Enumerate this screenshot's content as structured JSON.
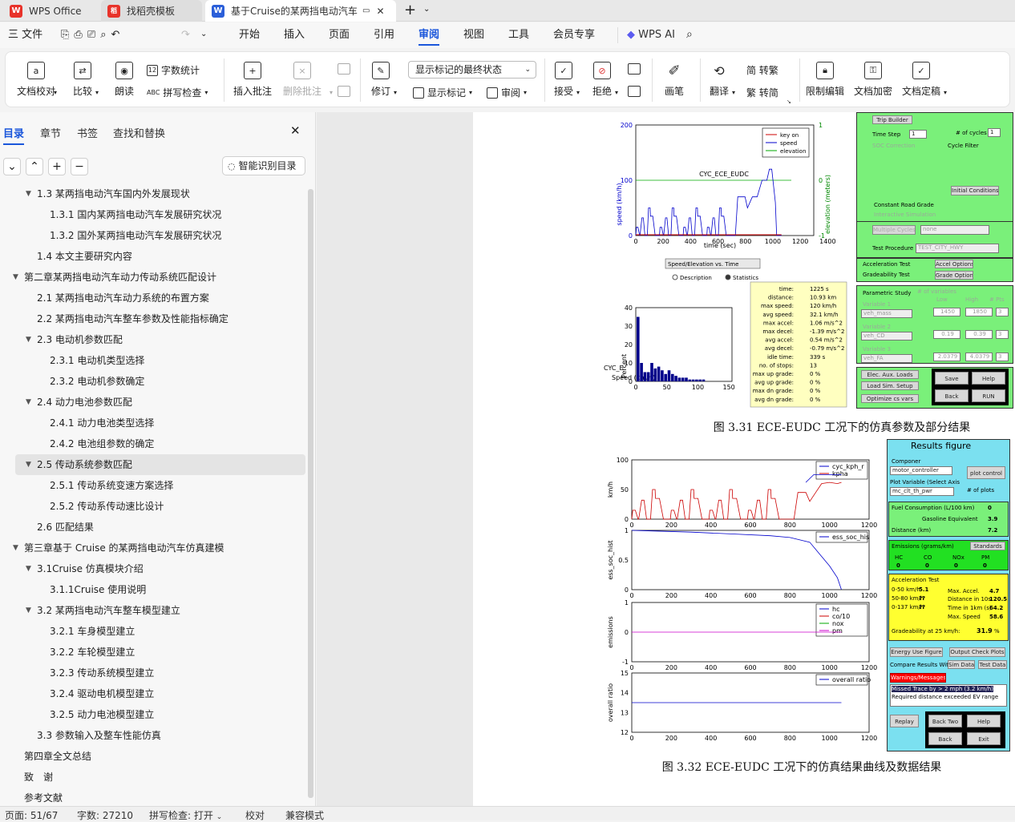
{
  "titlebar": {
    "tabs": [
      {
        "label": "WPS Office",
        "logo": "W"
      },
      {
        "label": "找稻壳模板",
        "logo": "稻"
      },
      {
        "label": "基于Cruise的某两挡电动汽车",
        "logo": "W"
      }
    ],
    "colors": {
      "wps_red": "#e8332a",
      "word_blue": "#2b5fd9",
      "accent": "#1a56db"
    }
  },
  "menubar": {
    "file": "三 文件",
    "items": [
      "开始",
      "插入",
      "页面",
      "引用",
      "审阅",
      "视图",
      "工具",
      "会员专享"
    ],
    "active": "审阅",
    "ai": "WPS AI"
  },
  "ribbon": {
    "proofread": "文档校对",
    "compare": "比较",
    "read_aloud": "朗读",
    "word_count": "字数统计",
    "spell_check": "拼写检查",
    "insert_comment": "插入批注",
    "delete_comment": "删除批注",
    "revise": "修订",
    "markup_dropdown": "显示标记的最终状态",
    "show_markup": "显示标记",
    "review": "审阅",
    "accept": "接受",
    "reject": "拒绝",
    "pen": "画笔",
    "translate": "翻译",
    "to_traditional": "简 转繁",
    "to_simplified": "繁 转简",
    "restrict_edit": "限制编辑",
    "encrypt": "文档加密",
    "finalize": "文档定稿"
  },
  "nav": {
    "tabs": [
      "目录",
      "章节",
      "书签",
      "查找和替换"
    ],
    "smart_toc": "智能识别目录",
    "toc": [
      {
        "text": "1.3 某两挡电动汽车国内外发展现状",
        "level": 2,
        "arrow": "down"
      },
      {
        "text": "1.3.1 国内某两挡电动汽车发展研究状况",
        "level": 3
      },
      {
        "text": "1.3.2 国外某两挡电动汽车发展研究状况",
        "level": 3
      },
      {
        "text": "1.4 本文主要研究内容",
        "level": 2
      },
      {
        "text": "第二章某两挡电动汽车动力传动系统匹配设计",
        "level": 1,
        "arrow": "down"
      },
      {
        "text": "2.1 某两挡电动汽车动力系统的布置方案",
        "level": 2
      },
      {
        "text": "2.2 某两挡电动汽车整车参数及性能指标确定",
        "level": 2
      },
      {
        "text": "2.3 电动机参数匹配",
        "level": 2,
        "arrow": "down"
      },
      {
        "text": "2.3.1 电动机类型选择",
        "level": 3
      },
      {
        "text": "2.3.2 电动机参数确定",
        "level": 3
      },
      {
        "text": "2.4 动力电池参数匹配",
        "level": 2,
        "arrow": "down"
      },
      {
        "text": "2.4.1 动力电池类型选择",
        "level": 3
      },
      {
        "text": "2.4.2 电池组参数的确定",
        "level": 3
      },
      {
        "text": "2.5 传动系统参数匹配",
        "level": 2,
        "arrow": "down",
        "selected": true
      },
      {
        "text": "2.5.1 传动系统变速方案选择",
        "level": 3
      },
      {
        "text": "2.5.2 传动系传动速比设计",
        "level": 3
      },
      {
        "text": "2.6 匹配结果",
        "level": 2
      },
      {
        "text": "第三章基于 Cruise 的某两挡电动汽车仿真建模",
        "level": 1,
        "arrow": "down"
      },
      {
        "text": "3.1Cruise 仿真模块介绍",
        "level": 2,
        "arrow": "down"
      },
      {
        "text": "3.1.1Cruise 使用说明",
        "level": 3
      },
      {
        "text": "3.2 某两挡电动汽车整车模型建立",
        "level": 2,
        "arrow": "down"
      },
      {
        "text": "3.2.1 车身模型建立",
        "level": 3
      },
      {
        "text": "3.2.2 车轮模型建立",
        "level": 3
      },
      {
        "text": "3.2.3 传动系统模型建立",
        "level": 3
      },
      {
        "text": "3.2.4 驱动电机模型建立",
        "level": 3
      },
      {
        "text": "3.2.5 动力电池模型建立",
        "level": 3
      },
      {
        "text": "3.3 参数输入及整车性能仿真",
        "level": 2
      },
      {
        "text": "第四章全文总结",
        "level": 1
      },
      {
        "text": "致　谢",
        "level": 1
      },
      {
        "text": "参考文献",
        "level": 1
      }
    ]
  },
  "status": {
    "page": "页面: 51/67",
    "words": "字数: 27210",
    "spell": "拼写检查: 打开",
    "proof": "校对",
    "compat": "兼容模式"
  },
  "figure1": {
    "caption": "图 3.31 ECE-EUDC 工况下的仿真参数及部分结果",
    "speed_plot": {
      "ylabel": "speed (km/h)",
      "y2label": "elevation (meters)",
      "xlabel": "time (sec)",
      "cycle": "CYC_ECE_EUDC",
      "yticks": [
        "200",
        "100",
        "0"
      ],
      "y2ticks": [
        "1",
        "0",
        "-1"
      ],
      "xticks": [
        "0",
        "200",
        "400",
        "600",
        "800",
        "1000",
        "1200",
        "1400"
      ],
      "legend": [
        "key on",
        "speed",
        "elevation"
      ]
    },
    "dropdown": "Speed/Elevation vs. Time",
    "radio_desc": "Description",
    "radio_stats": "Statistics",
    "hist": {
      "yticks": [
        "40",
        "30",
        "20",
        "10",
        "0"
      ],
      "xticks": [
        "0",
        "50",
        "100",
        "150"
      ],
      "ylabel": "Percent",
      "label1": "CYC_E",
      "label2": "Speed (km/h)"
    },
    "stats": [
      [
        "time:",
        "1225 s"
      ],
      [
        "distance:",
        "10.93 km"
      ],
      [
        "max speed:",
        "120 km/h"
      ],
      [
        "avg speed:",
        "32.1 km/h"
      ],
      [
        "max accel:",
        "1.06 m/s^2"
      ],
      [
        "max decel:",
        "-1.39 m/s^2"
      ],
      [
        "avg accel:",
        "0.54 m/s^2"
      ],
      [
        "avg decel:",
        "-0.79 m/s^2"
      ],
      [
        "idle time:",
        "339 s"
      ],
      [
        "no. of stops:",
        "13"
      ],
      [
        "max up grade:",
        "0 %"
      ],
      [
        "avg up grade:",
        "0 %"
      ],
      [
        "max dn grade:",
        "0 %"
      ],
      [
        "avg dn grade:",
        "0 %"
      ]
    ],
    "gui": {
      "trip_builder": "Trip Builder",
      "time_step": "Time Step",
      "time_step_val": "1",
      "cycles": "# of cycles",
      "cycles_val": "1",
      "soc": "SOC Correction",
      "cycle_filter": "Cycle Filter",
      "init_cond": "Initial Conditions",
      "const_grade": "Constant Road Grade",
      "interactive": "Interactive Simulation",
      "multiple": "Multiple Cycles",
      "none": "none",
      "test_proc": "Test Procedure",
      "test_val": "TEST_CITY_HWY",
      "accel_test": "Acceleration Test",
      "accel_opt": "Accel Options",
      "grade_test": "Gradeability Test",
      "grade_opt": "Grade Options",
      "param": "Parametric Study",
      "num_vars": "# of variables",
      "low": "Low",
      "high": "High",
      "pts": "# Pts",
      "var1": "Variable 1",
      "var1_name": "veh_mass",
      "v1_low": "1450",
      "v1_high": "1850",
      "v1_pts": "3",
      "var2": "Variable 2",
      "var2_name": "veh_CD",
      "v2_low": "0.19",
      "v2_high": "0.39",
      "v2_pts": "3",
      "var3": "Variable 3",
      "var3_name": "veh_FA",
      "v3_low": "2.0379",
      "v3_high": "4.0379",
      "v3_pts": "3",
      "elec": "Elec. Aux. Loads",
      "load_sim": "Load Sim. Setup",
      "optimize": "Optimize cs vars",
      "save": "Save",
      "help": "Help",
      "back": "Back",
      "run": "RUN"
    }
  },
  "figure2": {
    "caption": "图 3.32 ECE-EUDC 工况下的仿真结果曲线及数据结果",
    "xticks": [
      "0",
      "200",
      "400",
      "600",
      "800",
      "1000",
      "1200"
    ],
    "p1": {
      "ylabel": "km/h",
      "yticks": [
        "100",
        "50",
        "0"
      ],
      "legend": [
        "cyc_kph_r",
        "kpha"
      ]
    },
    "p2": {
      "ylabel": "ess_soc_hist",
      "yticks": [
        "1",
        "0.5",
        "0"
      ],
      "legend": [
        "ess_soc_his"
      ]
    },
    "p3": {
      "ylabel": "emissions",
      "yticks": [
        "1",
        "0",
        "-1"
      ],
      "legend": [
        "hc",
        "co/10",
        "nox",
        "pm"
      ]
    },
    "p4": {
      "ylabel": "overall ratio",
      "yticks": [
        "15",
        "14",
        "13",
        "12"
      ],
      "legend": [
        "overall ratio"
      ]
    },
    "results": {
      "title": "Results figure",
      "component": "Componer",
      "comp_val": "motor_controller",
      "plot_control": "plot control",
      "plot_var": "Plot Variable (Select Axis",
      "plot_var_val": "mc_clt_th_pwr",
      "num_plots": "# of plots",
      "fuel": "Fuel Consumption (L/100 km)",
      "fuel_val": "0",
      "gas": "Gasoline Equivalent",
      "gas_val": "3.9",
      "dist": "Distance (km)",
      "dist_val": "7.2",
      "emis": "Emissions (grams/km)",
      "standards": "Standards",
      "hc": "HC",
      "co": "CO",
      "nox": "NOx",
      "pm": "PM",
      "hc_v": "0",
      "co_v": "0",
      "nox_v": "0",
      "pm_v": "0",
      "accel": "Acceleration Test",
      "a1": "0-50 km/h",
      "a1v": "5.1",
      "a2": "50-80 km/h",
      "a2v": "??",
      "a3": "0-137 km/h",
      "a3v": "??",
      "maxacc": "Max. Accel.",
      "maxacc_v": "4.7",
      "dist10": "Distance in 10s",
      "dist10_v": "120.5",
      "time1k": "Time in 1km (s)",
      "time1k_v": "64.2",
      "maxspd": "Max. Speed",
      "maxspd_v": "58.6",
      "grade": "Gradeability at 25 km/h:",
      "grade_v": "31.9",
      "pct": "%",
      "energy": "Energy Use Figure",
      "output": "Output Check Plots",
      "compare": "Compare Results With:",
      "simdata": "Sim Data",
      "testdata": "Test Data",
      "warn": "Warnings/Messages",
      "msg1": "Missed Trace by > 2 mph (3.2 km/h)",
      "msg2": "Required distance exceeded EV range",
      "replay": "Replay",
      "backtwo": "Back Two",
      "help": "Help",
      "back": "Back",
      "exit": "Exit"
    }
  }
}
